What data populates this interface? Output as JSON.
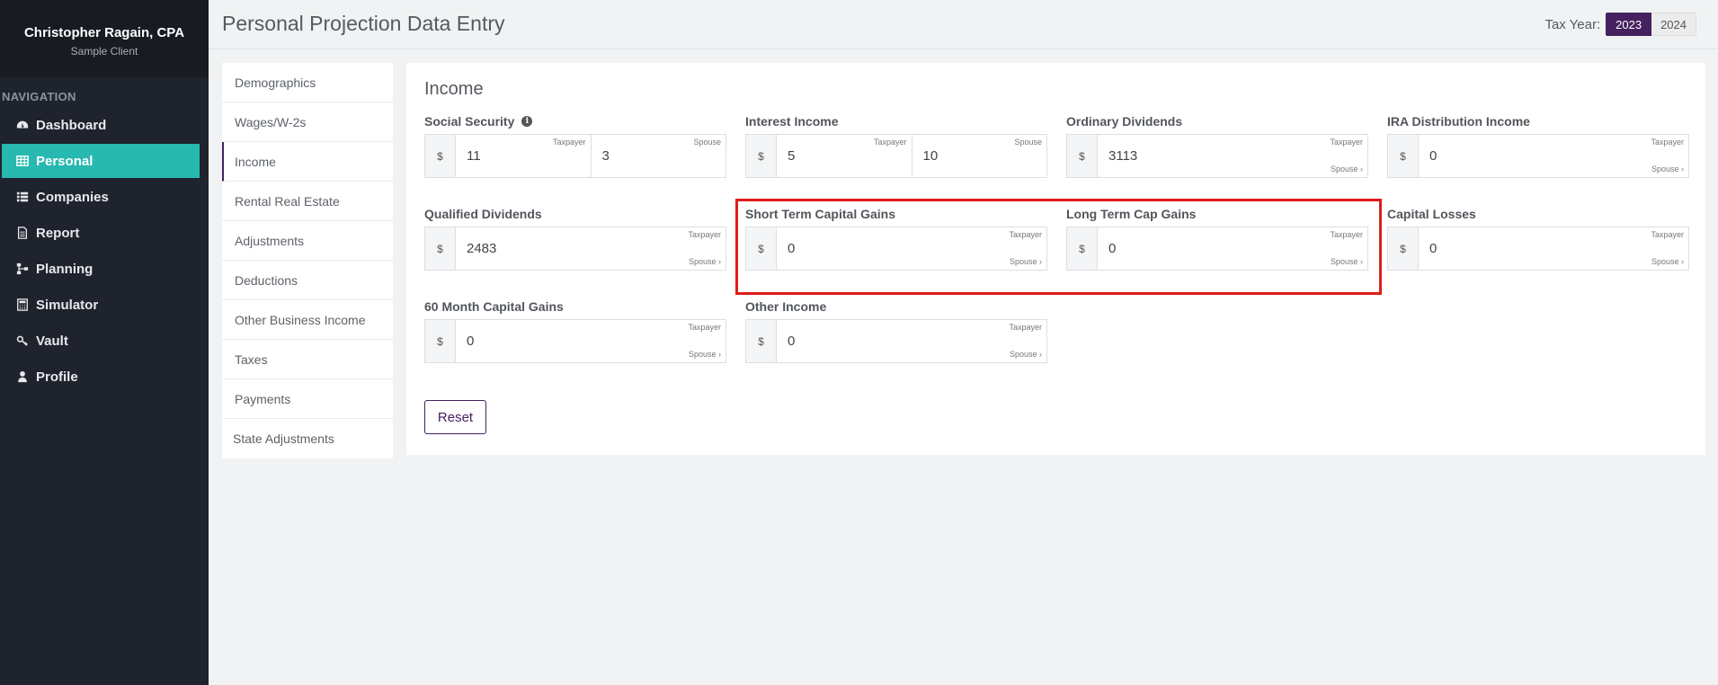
{
  "sidebar": {
    "user_name": "Christopher Ragain, CPA",
    "client_name": "Sample Client",
    "nav_title": "NAVIGATION",
    "items": [
      {
        "label": "Dashboard",
        "icon": "dashboard-icon"
      },
      {
        "label": "Personal",
        "icon": "table-icon",
        "active": true
      },
      {
        "label": "Companies",
        "icon": "list-icon"
      },
      {
        "label": "Report",
        "icon": "document-icon"
      },
      {
        "label": "Planning",
        "icon": "sitemap-icon"
      },
      {
        "label": "Simulator",
        "icon": "calculator-icon"
      },
      {
        "label": "Vault",
        "icon": "key-icon"
      },
      {
        "label": "Profile",
        "icon": "user-icon"
      }
    ]
  },
  "header": {
    "title": "Personal Projection Data Entry",
    "tax_year_label": "Tax Year:",
    "years": [
      "2023",
      "2024"
    ],
    "selected_year": "2023"
  },
  "subnav": {
    "items": [
      "Demographics",
      "Wages/W-2s",
      "Income",
      "Rental Real Estate",
      "Adjustments",
      "Deductions",
      "Other Business Income",
      "Taxes",
      "Payments",
      "State Adjustments"
    ],
    "active": "Income"
  },
  "main": {
    "section_title": "Income",
    "currency_symbol": "$",
    "taxpayer_tag": "Taxpayer",
    "spouse_tag": "Spouse",
    "spouse_link": "Spouse ›",
    "fields": {
      "social_security": {
        "label": "Social Security",
        "taxpayer": "11",
        "spouse": "3"
      },
      "interest_income": {
        "label": "Interest Income",
        "taxpayer": "5",
        "spouse": "10"
      },
      "ordinary_dividends": {
        "label": "Ordinary Dividends",
        "value": "3113"
      },
      "ira_distribution_income": {
        "label": "IRA Distribution Income",
        "value": "0"
      },
      "qualified_dividends": {
        "label": "Qualified Dividends",
        "value": "2483"
      },
      "short_term_capital_gains": {
        "label": "Short Term Capital Gains",
        "value": "0"
      },
      "long_term_cap_gains": {
        "label": "Long Term Cap Gains",
        "value": "0"
      },
      "capital_losses": {
        "label": "Capital Losses",
        "value": "0"
      },
      "sixty_month_capital_gains": {
        "label": "60 Month Capital Gains",
        "value": "0"
      },
      "other_income": {
        "label": "Other Income",
        "value": "0"
      }
    },
    "reset_label": "Reset"
  },
  "colors": {
    "sidebar_bg": "#1f232d",
    "active_nav": "#27b8b0",
    "brand_purple": "#45215f",
    "highlight_red": "#e01b1b"
  }
}
